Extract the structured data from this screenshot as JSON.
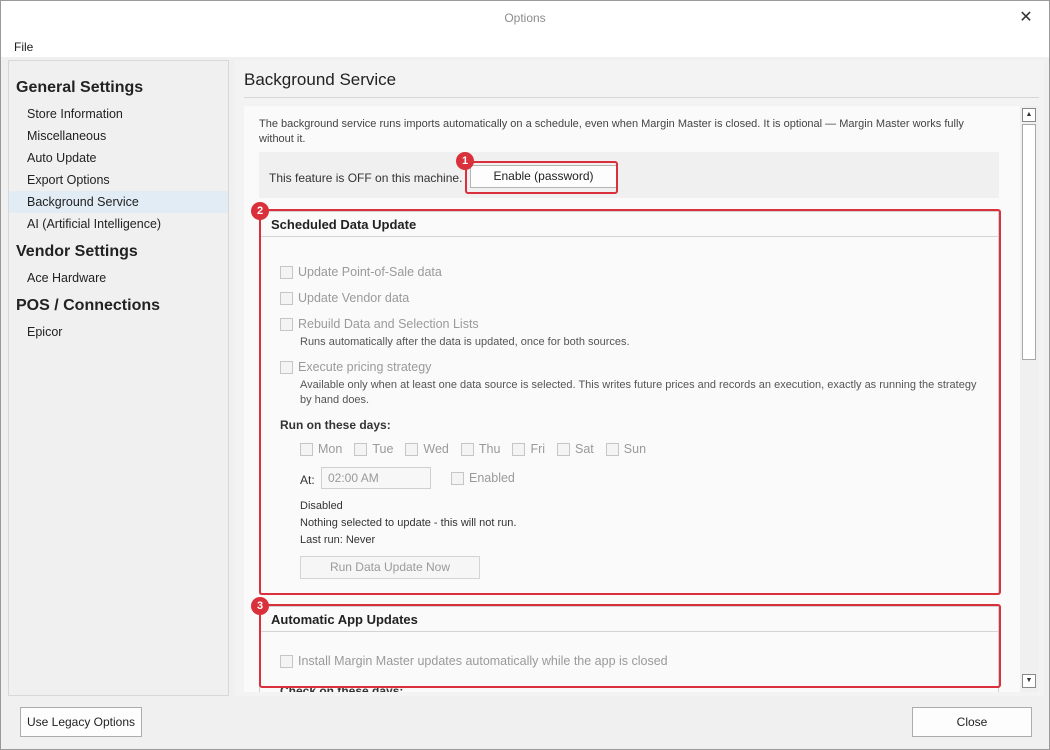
{
  "window": {
    "title": "Options",
    "close_glyph": "✕"
  },
  "menu": {
    "file": "File"
  },
  "sidebar": {
    "groups": [
      {
        "title": "General Settings",
        "items": [
          "Store Information",
          "Miscellaneous",
          "Auto Update",
          "Export Options",
          "Background Service",
          "AI (Artificial Intelligence)"
        ]
      },
      {
        "title": "Vendor Settings",
        "items": [
          "Ace Hardware"
        ]
      },
      {
        "title": "POS / Connections",
        "items": [
          "Epicor"
        ]
      }
    ],
    "active_item": "Background Service"
  },
  "main": {
    "title": "Background Service",
    "intro": "The background service runs imports automatically on a schedule, even when Margin Master is closed. It is optional — Margin Master works fully without it.",
    "status": {
      "text": "This feature is OFF on this machine.",
      "enable_button": "Enable (password)"
    },
    "scheduled": {
      "header": "Scheduled Data Update",
      "pos_label": "Update Point-of-Sale data",
      "vendor_label": "Update Vendor data",
      "rebuild_label": "Rebuild Data and Selection Lists",
      "rebuild_note": "Runs automatically after the data is updated, once for both sources.",
      "pricing_label": "Execute pricing strategy",
      "pricing_note": "Available only when at least one data source is selected. This writes future prices and records an execution, exactly as running the strategy by hand does.",
      "days_title": "Run on these days:",
      "days": [
        "Mon",
        "Tue",
        "Wed",
        "Thu",
        "Fri",
        "Sat",
        "Sun"
      ],
      "at_label": "At:",
      "time_value": "02:00 AM",
      "enabled_label": "Enabled",
      "state": "Disabled",
      "nothing_selected": "Nothing selected to update - this will not run.",
      "last_run": "Last run: Never",
      "run_now": "Run Data Update Now"
    },
    "app_updates": {
      "header": "Automatic App Updates",
      "install_label": "Install Margin Master updates automatically while the app is closed",
      "check_days_title": "Check on these days:"
    },
    "markers": [
      "1",
      "2",
      "3"
    ]
  },
  "footer": {
    "legacy": "Use Legacy Options",
    "close": "Close"
  },
  "colors": {
    "highlight": "#d9303b",
    "active_nav": "#e1ecf5"
  },
  "icons": {
    "scroll_up": "▲",
    "scroll_down": "▼"
  }
}
